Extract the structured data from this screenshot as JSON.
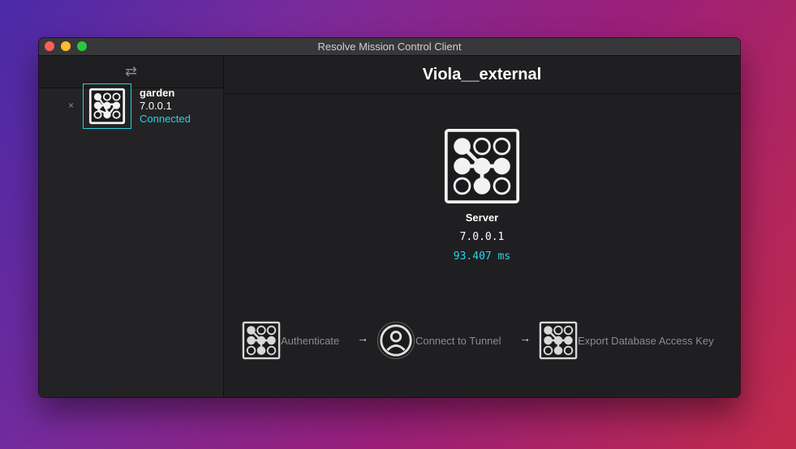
{
  "window": {
    "title": "Resolve Mission Control Client"
  },
  "sidebar": {
    "header_icon": "swap-arrows-icon",
    "header_glyph": "⇄",
    "servers": [
      {
        "name": "garden",
        "version": "7.0.0.1",
        "status": "Connected",
        "remove_glyph": "×"
      }
    ]
  },
  "main": {
    "title": "Viola__external",
    "server": {
      "label": "Server",
      "version": "7.0.0.1",
      "latency": "93.407 ms"
    },
    "steps": [
      {
        "label": "Authenticate",
        "icon": "resolve-logo-icon"
      },
      {
        "label": "Connect to Tunnel",
        "icon": "user-circle-icon"
      },
      {
        "label": "Export Database Access Key",
        "icon": "resolve-logo-icon"
      }
    ],
    "arrow_glyph": "→"
  },
  "colors": {
    "accent": "#29d3e6",
    "window_bg": "#1f1f21",
    "sidebar_bg": "#232325"
  }
}
